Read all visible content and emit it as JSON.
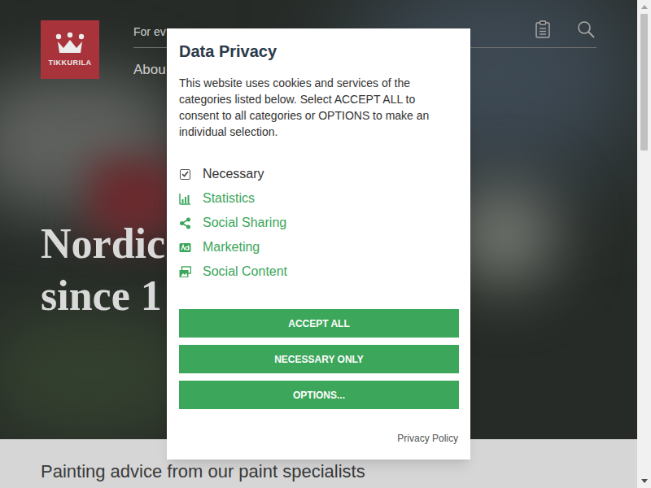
{
  "header": {
    "logo": "TIKKURILA",
    "nav_top": "For ev",
    "nav_sub": "Abou"
  },
  "hero": {
    "lines": [
      "Nordic",
      "since 1"
    ]
  },
  "section": {
    "title": "Painting advice from our paint specialists"
  },
  "dialog": {
    "title": "Data Privacy",
    "text": "This website uses cookies and services of the categories listed below. Select ACCEPT ALL to consent to all categories or OPTIONS to make an individual selection.",
    "categories": [
      {
        "label": "Necessary",
        "kind": "checkbox",
        "checked": true,
        "color": "#333333"
      },
      {
        "label": "Statistics",
        "kind": "link",
        "color": "#3ca65a"
      },
      {
        "label": "Social Sharing",
        "kind": "link",
        "color": "#3ca65a"
      },
      {
        "label": "Marketing",
        "kind": "link",
        "color": "#3ca65a"
      },
      {
        "label": "Social Content",
        "kind": "link",
        "color": "#3ca65a"
      }
    ],
    "buttons": [
      "ACCEPT ALL",
      "NECESSARY ONLY",
      "OPTIONS..."
    ],
    "link": "Privacy Policy"
  }
}
